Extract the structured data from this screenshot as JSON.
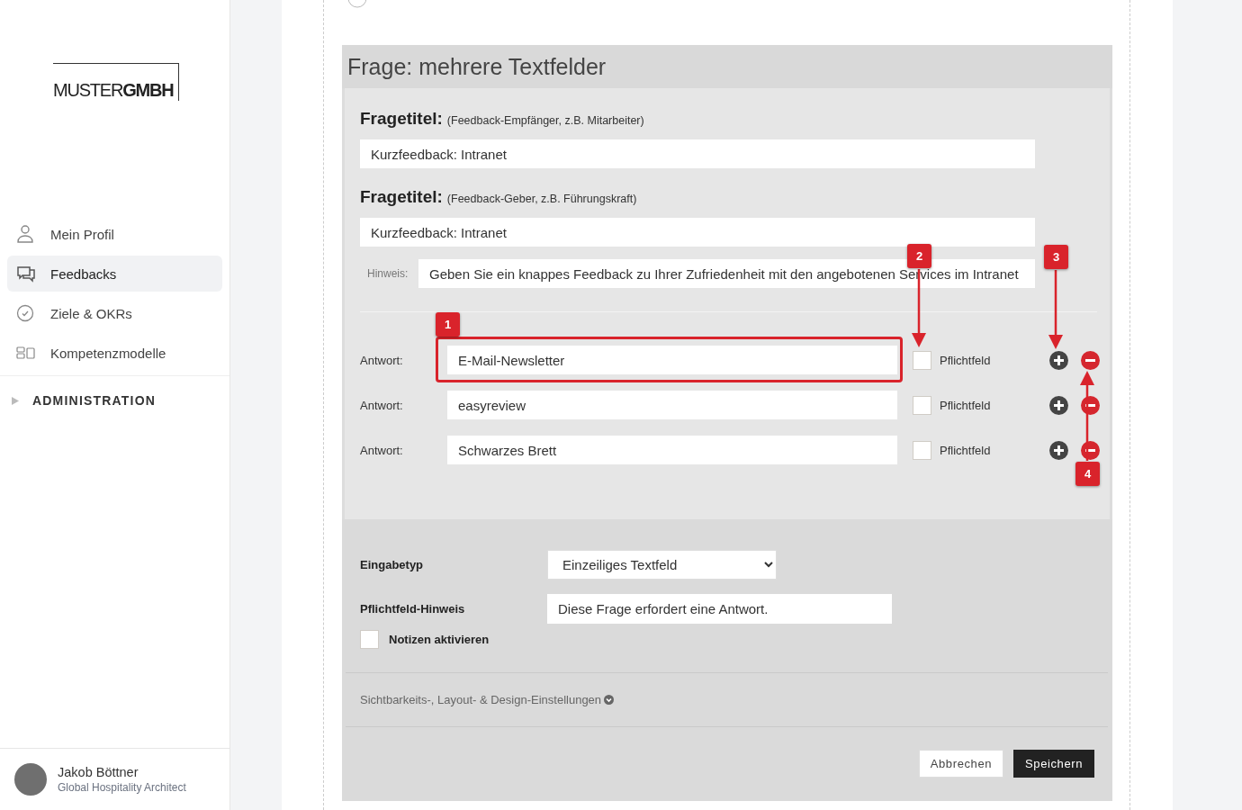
{
  "sidebar": {
    "logo": "MUSTER**GMBH**",
    "nav": [
      {
        "label": "Mein Profil",
        "selected": false
      },
      {
        "label": "Feedbacks",
        "selected": true
      },
      {
        "label": "Ziele & OKRs",
        "selected": false
      },
      {
        "label": "Kompetenzmodelle",
        "selected": false
      }
    ],
    "section": {
      "label": "ADMINISTRATION",
      "expanded": false
    },
    "user": {
      "name": "Jakob Böttner",
      "role": "Global Hospitality Architect"
    }
  },
  "top_option": {
    "selected": false
  },
  "question": {
    "title": "Frage: mehrere Textfelder",
    "title_fields": [
      {
        "label": "Fragetitel:",
        "hint": "(Feedback-Empfänger, z.B. Mitarbeiter)",
        "value": "Kurzfeedback: Intranet"
      },
      {
        "label": "Fragetitel:",
        "hint": "(Feedback-Geber, z.B. Führungskraft)",
        "value": "Kurzfeedback: Intranet"
      }
    ],
    "hint": {
      "label": "Hinweis:",
      "value": "Geben Sie ein knappes Feedback zu Ihrer Zufriedenheit mit den angebotenen Services im Intranet"
    },
    "answers": [
      {
        "label": "Antwort:",
        "value": "E-Mail-Newsletter",
        "required": false,
        "required_label": "Pflichtfeld"
      },
      {
        "label": "Antwort:",
        "value": "easyreview",
        "required": false,
        "required_label": "Pflichtfeld"
      },
      {
        "label": "Antwort:",
        "value": "Schwarzes Brett",
        "required": false,
        "required_label": "Pflichtfeld"
      }
    ],
    "input_type": {
      "label": "Eingabetyp",
      "value": "Einzeiliges Textfeld"
    },
    "required_hint": {
      "label": "Pflichtfeld-Hinweis",
      "value": "Diese Frage erfordert eine Antwort."
    },
    "notes": {
      "label": "Notizen aktivieren",
      "checked": false
    },
    "settings_link": "Sichtbarkeits-, Layout- & Design-Einstellungen",
    "buttons": [
      {
        "label": "Abbrechen",
        "kind": "secondary"
      },
      {
        "label": "Speichern",
        "kind": "primary"
      }
    ]
  },
  "annotations": [
    {
      "label": "1"
    },
    {
      "label": "2"
    },
    {
      "label": "3"
    },
    {
      "label": "4"
    }
  ]
}
